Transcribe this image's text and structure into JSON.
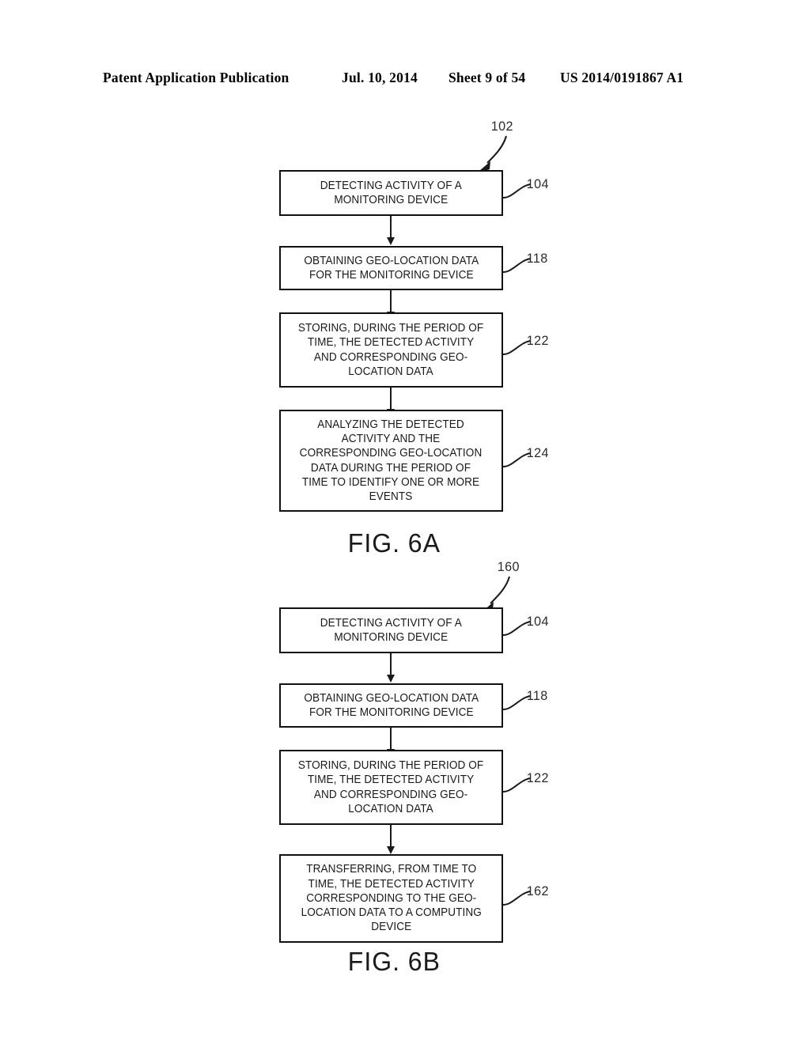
{
  "header": {
    "publication": "Patent Application Publication",
    "date": "Jul. 10, 2014",
    "sheet": "Sheet 9 of 54",
    "patent_number": "US 2014/0191867 A1"
  },
  "figures": [
    {
      "id": "fig-6a",
      "caption": "FIG. 6A",
      "flow_reference": "102",
      "steps": [
        {
          "ref": "104",
          "text": "DETECTING ACTIVITY OF A\nMONITORING DEVICE"
        },
        {
          "ref": "118",
          "text": "OBTAINING GEO-LOCATION DATA\nFOR THE MONITORING DEVICE"
        },
        {
          "ref": "122",
          "text": "STORING, DURING THE PERIOD OF\nTIME, THE DETECTED ACTIVITY\nAND CORRESPONDING GEO-\nLOCATION DATA"
        },
        {
          "ref": "124",
          "text": "ANALYZING THE DETECTED\nACTIVITY AND THE\nCORRESPONDING GEO-LOCATION\nDATA DURING THE PERIOD OF\nTIME TO IDENTIFY ONE OR MORE\nEVENTS"
        }
      ]
    },
    {
      "id": "fig-6b",
      "caption": "FIG. 6B",
      "flow_reference": "160",
      "steps": [
        {
          "ref": "104",
          "text": "DETECTING ACTIVITY OF A\nMONITORING DEVICE"
        },
        {
          "ref": "118",
          "text": "OBTAINING GEO-LOCATION DATA\nFOR THE MONITORING DEVICE"
        },
        {
          "ref": "122",
          "text": "STORING, DURING THE PERIOD OF\nTIME, THE DETECTED ACTIVITY\nAND CORRESPONDING GEO-\nLOCATION DATA"
        },
        {
          "ref": "162",
          "text": "TRANSFERRING, FROM TIME TO\nTIME, THE DETECTED ACTIVITY\nCORRESPONDING TO THE GEO-\nLOCATION DATA TO A COMPUTING\nDEVICE"
        }
      ]
    }
  ],
  "colors": {
    "ink": "#1a1a1a",
    "paper": "#ffffff"
  }
}
